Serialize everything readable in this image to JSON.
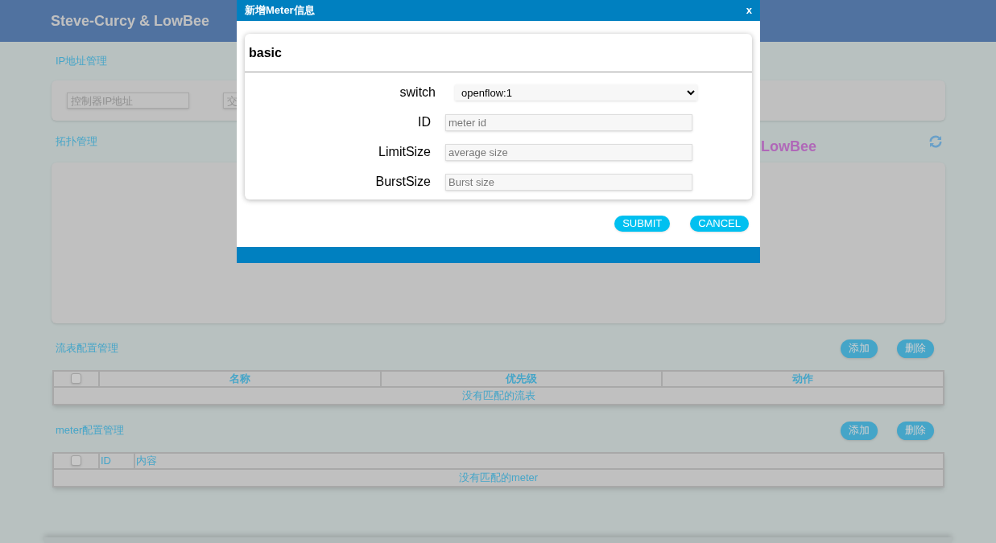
{
  "header": {
    "title": "Steve-Curcy & LowBee"
  },
  "ip_section": {
    "title": "IP地址管理",
    "fields": [
      {
        "placeholder": "控制器IP地址"
      },
      {
        "placeholder": "交"
      }
    ]
  },
  "topology_section": {
    "title": "拓扑管理",
    "graph_title": "LowBee"
  },
  "flow_section": {
    "title": "流表配置管理",
    "buttons": [
      "添加",
      "删除"
    ],
    "table": {
      "select_all_checked": false,
      "columns": [
        "名称",
        "优先级",
        "动作"
      ],
      "empty_text": "没有匹配的流表"
    }
  },
  "meter_section": {
    "title": "meter配置管理",
    "buttons": [
      "添加",
      "删除"
    ],
    "table": {
      "select_all_checked": false,
      "columns": [
        "ID",
        "内容"
      ],
      "empty_text": "没有匹配的meter"
    }
  },
  "dialog": {
    "title": "新增Meter信息",
    "close": "x",
    "card_title": "basic",
    "fields": [
      {
        "kind": "select",
        "label": "switch",
        "value": "openflow:1"
      },
      {
        "kind": "text",
        "label": "ID",
        "placeholder": "meter id"
      },
      {
        "kind": "text",
        "label": "LimitSize",
        "placeholder": "average size"
      },
      {
        "kind": "text",
        "label": "BurstSize",
        "placeholder": "Burst size"
      }
    ],
    "buttons": [
      "SUBMIT",
      "CANCEL"
    ]
  }
}
